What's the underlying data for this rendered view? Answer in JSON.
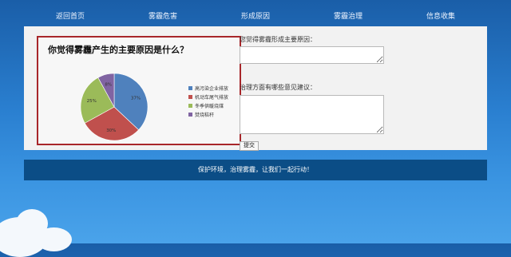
{
  "nav": [
    "返回首页",
    "雾霾危害",
    "形成原因",
    "雾霾治理",
    "信息收集"
  ],
  "chart_data": {
    "type": "pie",
    "title": "你觉得雾霾产生的主要原因是什么？",
    "categories": [
      "高污染企业排放",
      "机动车尾气排放",
      "冬季供暖烧煤",
      "焚烧秸秆"
    ],
    "values": [
      37,
      30,
      25,
      8
    ],
    "value_labels": [
      "37%",
      "30%",
      "25%",
      "8%"
    ],
    "colors": [
      "#4f81bd",
      "#c0504d",
      "#9bbb59",
      "#8064a2"
    ],
    "legend_position": "right"
  },
  "form": {
    "question1_label": "您觉得雾霾形成主要原因：",
    "question2_label": "治理方面有哪些意见建议：",
    "submit_label": "提交"
  },
  "footer": {
    "text": "保护环境，治理雾霾，让我们一起行动！"
  }
}
